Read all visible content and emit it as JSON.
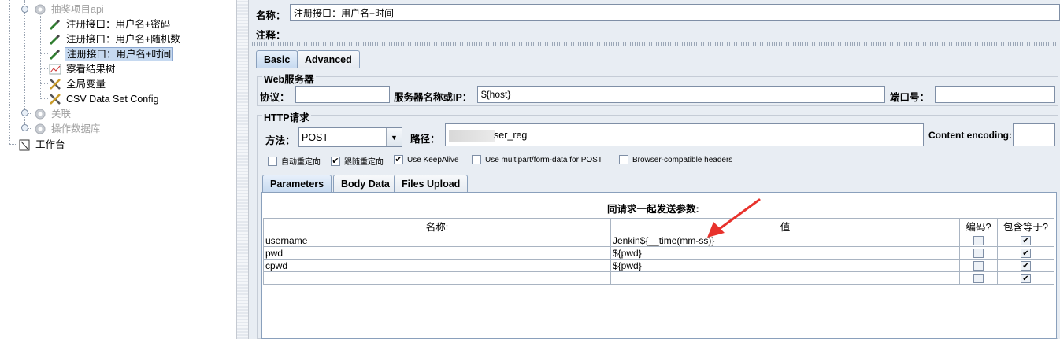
{
  "tree": {
    "items": [
      {
        "label": "抽奖项目api",
        "icon": "gear-icon",
        "disabled": true
      },
      {
        "label": "注册接口：用户名+密码",
        "icon": "pipette-icon"
      },
      {
        "label": "注册接口：用户名+随机数",
        "icon": "pipette-icon"
      },
      {
        "label": "注册接口：用户名+时间",
        "icon": "pipette-icon",
        "selected": true
      },
      {
        "label": "察看结果树",
        "icon": "chart-icon"
      },
      {
        "label": "全局变量",
        "icon": "wrench-icon"
      },
      {
        "label": "CSV Data Set Config",
        "icon": "wrench-icon"
      },
      {
        "label": "关联",
        "icon": "gear-icon",
        "disabled": true
      },
      {
        "label": "操作数据库",
        "icon": "gear-icon",
        "disabled": true
      },
      {
        "label": "工作台",
        "icon": "clipboard-icon"
      }
    ]
  },
  "header": {
    "name_label": "名称：",
    "name_value": "注册接口：用户名+时间",
    "comment_label": "注释："
  },
  "tabs": {
    "basic": "Basic",
    "advanced": "Advanced"
  },
  "web_server": {
    "title": "Web服务器",
    "protocol_label": "协议：",
    "protocol_value": "",
    "server_label": "服务器名称或IP：",
    "server_value": "${host}",
    "port_label": "端口号：",
    "port_value": ""
  },
  "http_request": {
    "title": "HTTP请求",
    "method_label": "方法：",
    "method_value": "POST",
    "path_label": "路径：",
    "path_value": "ser_reg",
    "encoding_label": "Content encoding:",
    "encoding_value": "",
    "options": [
      {
        "label": "自动重定向",
        "checked": false
      },
      {
        "label": "跟随重定向",
        "checked": true
      },
      {
        "label": "Use KeepAlive",
        "checked": true
      },
      {
        "label": "Use multipart/form-data for POST",
        "checked": false
      },
      {
        "label": "Browser-compatible headers",
        "checked": false
      }
    ]
  },
  "subtabs": {
    "parameters": "Parameters",
    "body_data": "Body Data",
    "files_upload": "Files Upload"
  },
  "params_table": {
    "caption": "同请求一起发送参数:",
    "columns": [
      "名称:",
      "值",
      "编码?",
      "包含等于?"
    ],
    "rows": [
      {
        "name": "username",
        "value": "Jenkin${__time(mm-ss)}",
        "encode": false,
        "include_equals": true
      },
      {
        "name": "pwd",
        "value": "${pwd}",
        "encode": false,
        "include_equals": true
      },
      {
        "name": "cpwd",
        "value": "${pwd}",
        "encode": false,
        "include_equals": true
      },
      {
        "name": "",
        "value": "",
        "encode": false,
        "include_equals": true
      }
    ]
  },
  "colors": {
    "annotation_arrow": "#e8322c",
    "selected_bg": "#c6d9f0",
    "panel_bg": "#e8edf3"
  }
}
